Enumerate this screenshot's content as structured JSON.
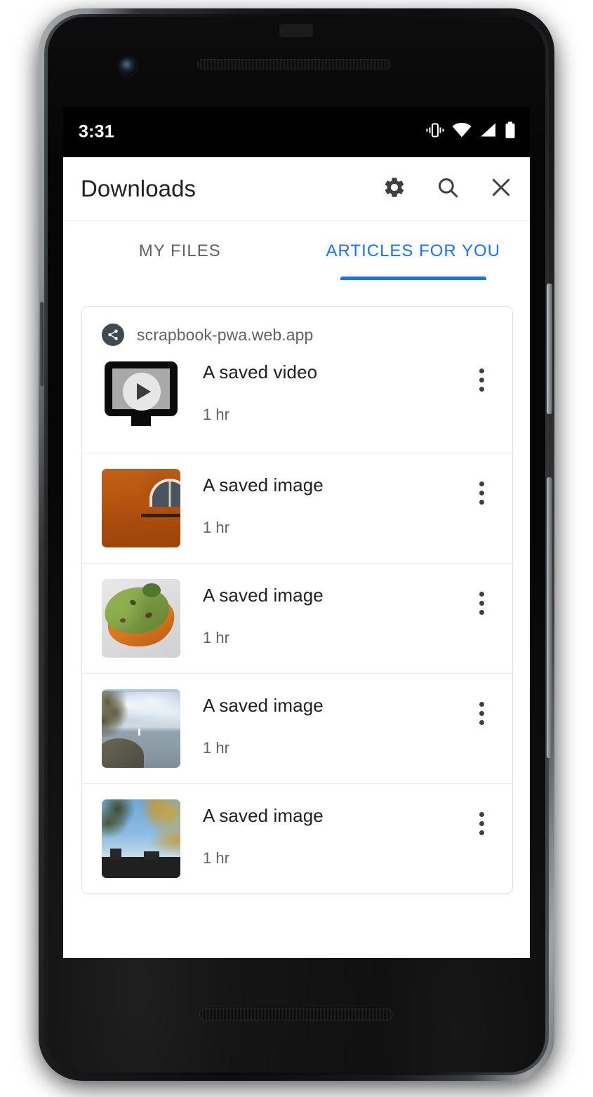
{
  "status_bar": {
    "time": "3:31",
    "icons": [
      "vibrate-icon",
      "wifi-icon",
      "signal-icon",
      "battery-icon"
    ]
  },
  "app_bar": {
    "title": "Downloads",
    "actions": [
      {
        "name": "settings-button",
        "icon": "gear-icon"
      },
      {
        "name": "search-button",
        "icon": "search-icon"
      },
      {
        "name": "close-button",
        "icon": "close-icon"
      }
    ]
  },
  "tabs": [
    {
      "label": "MY FILES",
      "active": false
    },
    {
      "label": "ARTICLES FOR YOU",
      "active": true
    }
  ],
  "card": {
    "source_icon": "share-icon",
    "source": "scrapbook-pwa.web.app",
    "rows": [
      {
        "title": "A saved video",
        "subtitle": "1 hr",
        "thumb": "video-play-thumbnail",
        "overflow": "overflow-menu-icon"
      },
      {
        "title": "A saved image",
        "subtitle": "1 hr",
        "thumb": "orange-wall-thumbnail",
        "overflow": "overflow-menu-icon"
      },
      {
        "title": "A saved image",
        "subtitle": "1 hr",
        "thumb": "avocado-toast-thumbnail",
        "overflow": "overflow-menu-icon"
      },
      {
        "title": "A saved image",
        "subtitle": "1 hr",
        "thumb": "lake-shore-thumbnail",
        "overflow": "overflow-menu-icon"
      },
      {
        "title": "A saved image",
        "subtitle": "1 hr",
        "thumb": "city-skyline-thumbnail",
        "overflow": "overflow-menu-icon"
      }
    ]
  },
  "colors": {
    "accent": "#1a73e8",
    "text_primary": "#202124",
    "text_secondary": "#5f6368",
    "badge": "#3e4c52",
    "divider": "#e8eaed",
    "status_bar": "#000000"
  }
}
